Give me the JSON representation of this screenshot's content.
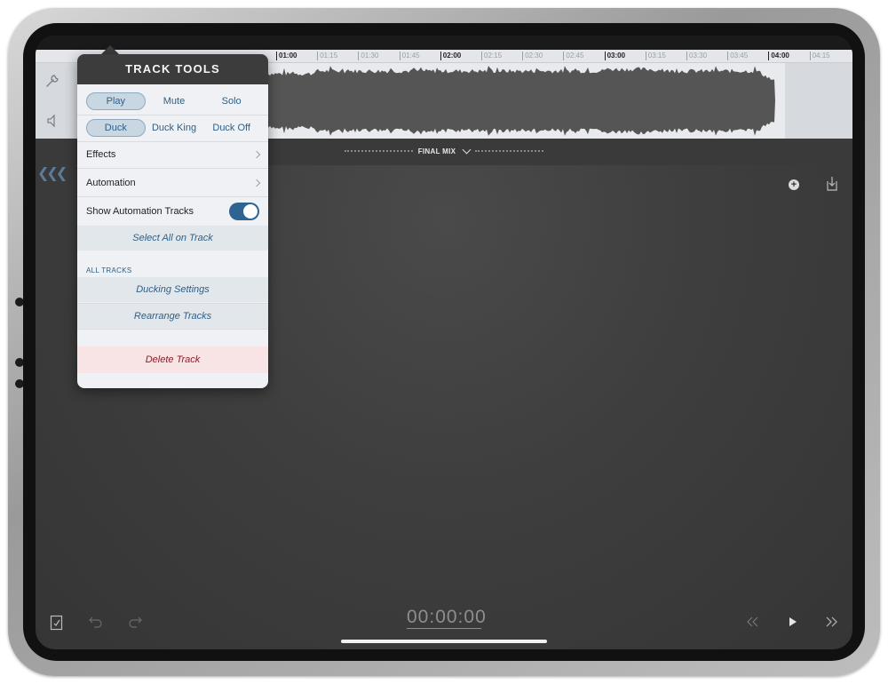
{
  "timeline": {
    "ticks": [
      {
        "label": "01:00",
        "major": true
      },
      {
        "label": "01:15",
        "major": false
      },
      {
        "label": "01:30",
        "major": false
      },
      {
        "label": "01:45",
        "major": false
      },
      {
        "label": "02:00",
        "major": true
      },
      {
        "label": "02:15",
        "major": false
      },
      {
        "label": "02:30",
        "major": false
      },
      {
        "label": "02:45",
        "major": false
      },
      {
        "label": "03:00",
        "major": true
      },
      {
        "label": "03:15",
        "major": false
      },
      {
        "label": "03:30",
        "major": false
      },
      {
        "label": "03:45",
        "major": false
      },
      {
        "label": "04:00",
        "major": true
      },
      {
        "label": "04:15",
        "major": false
      }
    ]
  },
  "mix": {
    "label": "FINAL MIX"
  },
  "popover": {
    "title": "TRACK TOOLS",
    "row1": [
      "Play",
      "Mute",
      "Solo"
    ],
    "row2": [
      "Duck",
      "Duck King",
      "Duck Off"
    ],
    "row1_active": "Play",
    "row2_active": "Duck",
    "effects": "Effects",
    "automation": "Automation",
    "show_automation": "Show Automation Tracks",
    "show_automation_on": true,
    "select_all": "Select All on Track",
    "all_tracks_header": "ALL TRACKS",
    "ducking_settings": "Ducking Settings",
    "rearrange": "Rearrange Tracks",
    "delete": "Delete Track"
  },
  "transport": {
    "timecode": "00:00:00"
  },
  "colors": {
    "accent": "#2f6391",
    "delete": "#8d1d2a",
    "waveform": "#555555"
  }
}
